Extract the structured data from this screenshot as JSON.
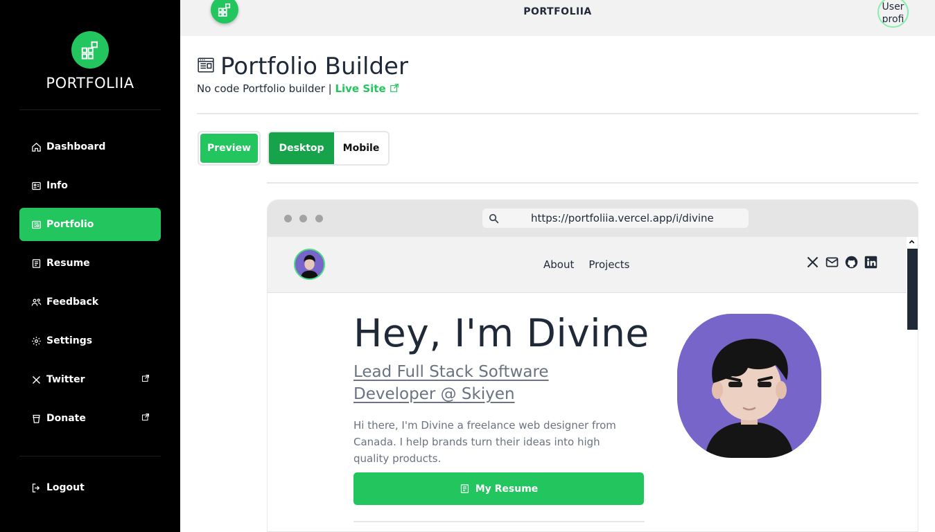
{
  "sidebar": {
    "brand": "PORTFOLIIA",
    "items": [
      {
        "label": "Dashboard",
        "icon": "home-icon"
      },
      {
        "label": "Info",
        "icon": "id-card-icon"
      },
      {
        "label": "Portfolio",
        "icon": "newspaper-icon",
        "active": true
      },
      {
        "label": "Resume",
        "icon": "document-icon"
      },
      {
        "label": "Feedback",
        "icon": "users-icon"
      },
      {
        "label": "Settings",
        "icon": "gear-icon"
      },
      {
        "label": "Twitter",
        "icon": "x-icon",
        "external": true
      },
      {
        "label": "Donate",
        "icon": "coffee-icon",
        "external": true
      }
    ],
    "logout": "Logout"
  },
  "topbar": {
    "title": "PORTFOLIIA",
    "user_pic_alt": "User profi"
  },
  "page": {
    "title": "Portfolio Builder",
    "subtitle": "No code Portfolio builder | ",
    "live_site": "Live Site",
    "preview_label": "Preview",
    "desktop_label": "Desktop",
    "mobile_label": "Mobile"
  },
  "browser": {
    "url": "https://portfoliia.vercel.app/i/divine",
    "nav_links": [
      "About",
      "Projects"
    ],
    "socials": [
      "x-icon",
      "mail-icon",
      "github-icon",
      "linkedin-icon"
    ]
  },
  "hero": {
    "title": "Hey, I'm Divine",
    "role": "Lead Full Stack Software Developer @ Skiyen",
    "description": "Hi there, I'm Divine a freelance web designer from Canada. I help brands turn their ideas into high quality products.",
    "resume_button": "My Resume"
  },
  "colors": {
    "accent": "#22c55e",
    "accent_dark": "#16a34a",
    "sidebar_bg": "#000000",
    "avatar_bg": "#7765c9"
  }
}
